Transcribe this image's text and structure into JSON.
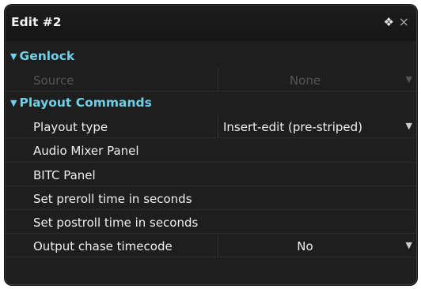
{
  "window": {
    "title": "Edit #2",
    "pin_glyph": "❖",
    "close_glyph": "×"
  },
  "sections": [
    {
      "label": "Genlock",
      "rows": [
        {
          "name": "Source",
          "value": "None",
          "dropdown": true,
          "disabled": true
        }
      ]
    },
    {
      "label": "Playout Commands",
      "rows": [
        {
          "name": "Playout type",
          "value": "Insert-edit (pre-striped)",
          "dropdown": true,
          "disabled": false
        },
        {
          "name": "Audio Mixer Panel",
          "value": "",
          "dropdown": false,
          "disabled": false
        },
        {
          "name": "BITC Panel",
          "value": "",
          "dropdown": false,
          "disabled": false
        },
        {
          "name": "Set preroll time in seconds",
          "value": "",
          "dropdown": false,
          "disabled": false
        },
        {
          "name": "Set postroll time in seconds",
          "value": "",
          "dropdown": false,
          "disabled": false
        },
        {
          "name": "Output chase timecode",
          "value": "No",
          "dropdown": true,
          "disabled": false
        }
      ]
    }
  ],
  "icons": {
    "expand": "triangle-down-icon",
    "dropdown": "chevron-down-icon",
    "pin": "pin-icon",
    "close": "close-icon"
  },
  "colors": {
    "section_header": "#6fd0e8",
    "panel_bg": "#1e1e1e",
    "text": "#f0f0f0",
    "disabled_text": "#555555"
  }
}
